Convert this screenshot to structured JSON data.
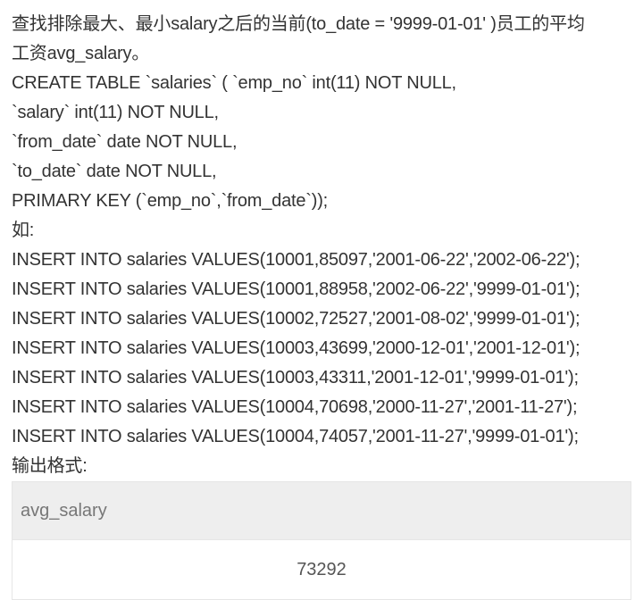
{
  "problem": {
    "lines": [
      "查找排除最大、最小salary之后的当前(to_date = '9999-01-01' )员工的平均",
      "工资avg_salary。",
      "CREATE TABLE `salaries` ( `emp_no` int(11) NOT NULL,",
      "`salary` int(11) NOT NULL,",
      "`from_date` date NOT NULL,",
      "`to_date` date NOT NULL,",
      "PRIMARY KEY (`emp_no`,`from_date`));",
      "如:",
      "INSERT INTO salaries VALUES(10001,85097,'2001-06-22','2002-06-22');",
      "INSERT INTO salaries VALUES(10001,88958,'2002-06-22','9999-01-01');",
      "INSERT INTO salaries VALUES(10002,72527,'2001-08-02','9999-01-01');",
      "INSERT INTO salaries VALUES(10003,43699,'2000-12-01','2001-12-01');",
      "INSERT INTO salaries VALUES(10003,43311,'2001-12-01','9999-01-01');",
      "INSERT INTO salaries VALUES(10004,70698,'2000-11-27','2001-11-27');",
      "INSERT INTO salaries VALUES(10004,74057,'2001-11-27','9999-01-01');",
      "输出格式:"
    ]
  },
  "output_table": {
    "header": "avg_salary",
    "value": "73292"
  },
  "colors": {
    "text": "#333333",
    "header_bg": "#eeeeee",
    "header_text": "#777777",
    "border": "#e6e6e6"
  }
}
